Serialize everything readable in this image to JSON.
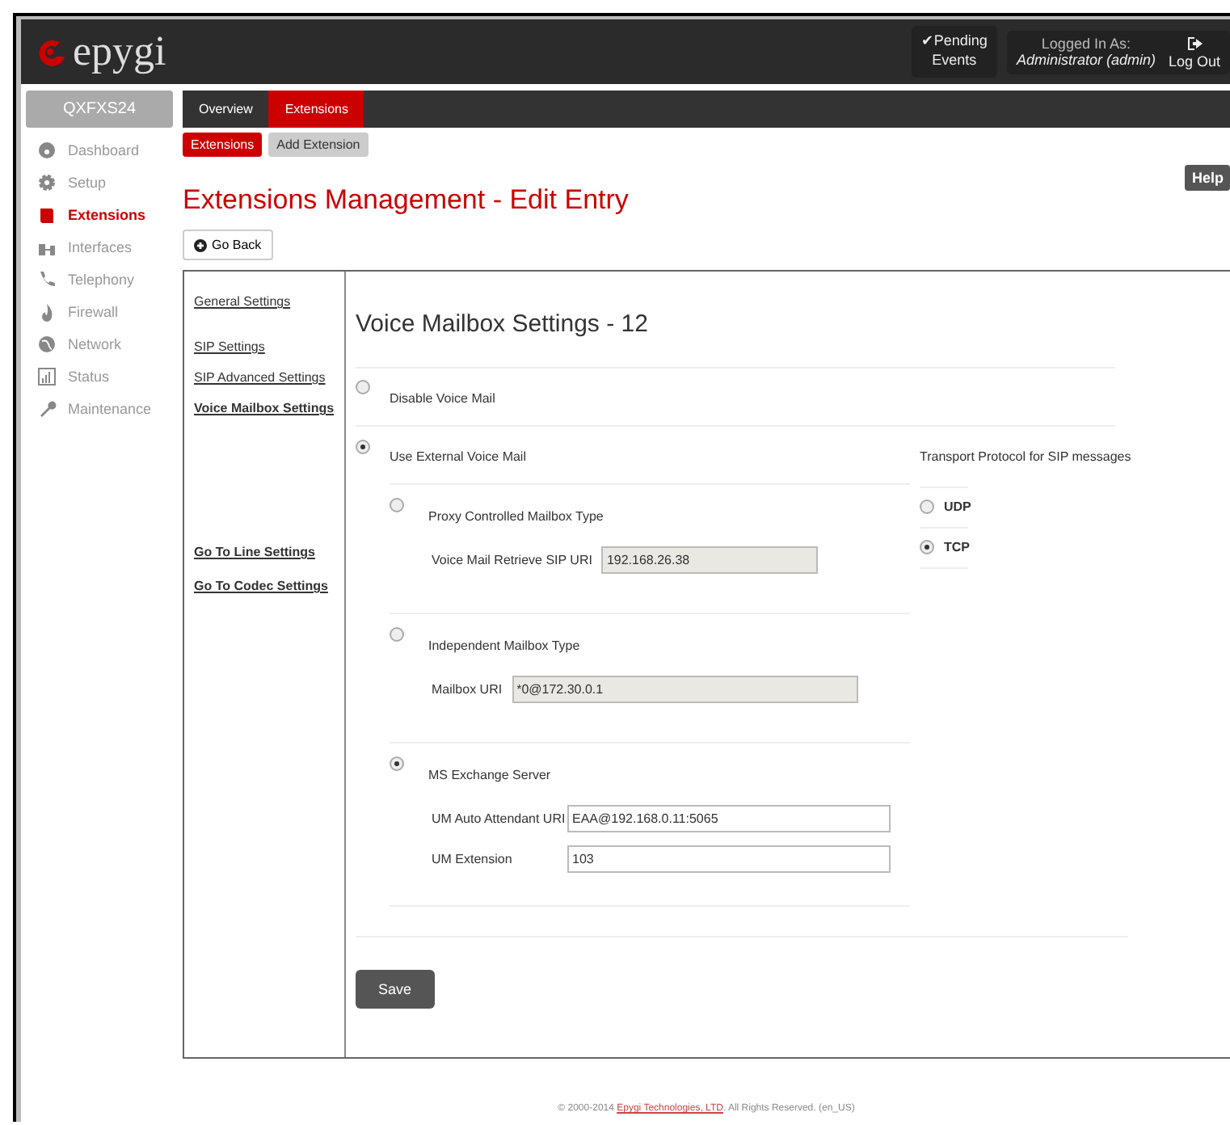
{
  "header": {
    "logo": "epygi",
    "pending": {
      "mark": "✔",
      "lines": [
        "Pending",
        "Events"
      ]
    },
    "logged_in_label": "Logged In As:",
    "user": "Administrator (admin)",
    "logout": "Log Out"
  },
  "sidebar": {
    "device": "QXFXS24",
    "items": [
      {
        "label": "Dashboard",
        "selected": false
      },
      {
        "label": "Setup",
        "selected": false
      },
      {
        "label": "Extensions",
        "selected": true
      },
      {
        "label": "Interfaces",
        "selected": false
      },
      {
        "label": "Telephony",
        "selected": false
      },
      {
        "label": "Firewall",
        "selected": false
      },
      {
        "label": "Network",
        "selected": false
      },
      {
        "label": "Status",
        "selected": false
      },
      {
        "label": "Maintenance",
        "selected": false
      }
    ]
  },
  "tabs": [
    {
      "label": "Overview",
      "selected": false
    },
    {
      "label": "Extensions",
      "selected": true
    }
  ],
  "subtabs": [
    {
      "label": "Extensions",
      "selected": true
    },
    {
      "label": "Add Extension",
      "selected": false
    }
  ],
  "help": "Help",
  "title": "Extensions Management - Edit Entry",
  "go_back": "Go Back",
  "nav": {
    "links": [
      {
        "label": "General Settings",
        "selected": false
      },
      {
        "label": "SIP Settings",
        "selected": false
      },
      {
        "label": "SIP Advanced Settings",
        "selected": false
      },
      {
        "label": "Voice Mailbox Settings",
        "selected": true
      }
    ],
    "goto": [
      "Go To Line Settings",
      "Go To Codec Settings"
    ]
  },
  "form": {
    "heading": "Voice Mailbox Settings - 12",
    "disable": {
      "label": "Disable Voice Mail",
      "selected": false
    },
    "external": {
      "label": "Use External Voice Mail",
      "selected": true,
      "types": [
        {
          "label": "Proxy Controlled Mailbox Type",
          "selected": false,
          "fields": [
            {
              "label": "Voice Mail Retrieve SIP URI",
              "value": "192.168.26.38",
              "disabled": true
            }
          ]
        },
        {
          "label": "Independent Mailbox Type",
          "selected": false,
          "fields": [
            {
              "label": "Mailbox URI",
              "value": "*0@172.30.0.1",
              "disabled": true
            }
          ]
        },
        {
          "label": "MS Exchange Server",
          "selected": true,
          "fields": [
            {
              "label": "UM Auto Attendant URI",
              "value": "EAA@192.168.0.11:5065",
              "disabled": false
            },
            {
              "label": "UM Extension",
              "value": "103",
              "disabled": false
            }
          ]
        }
      ]
    },
    "transport": {
      "label": "Transport Protocol for SIP messages",
      "options": [
        {
          "label": "UDP",
          "selected": false
        },
        {
          "label": "TCP",
          "selected": true
        }
      ]
    },
    "save": "Save"
  },
  "footer": {
    "before": "© 2000-2014",
    "link": "Epygi Technologies, LTD",
    "after": ". All Rights Reserved. (en_US)"
  }
}
